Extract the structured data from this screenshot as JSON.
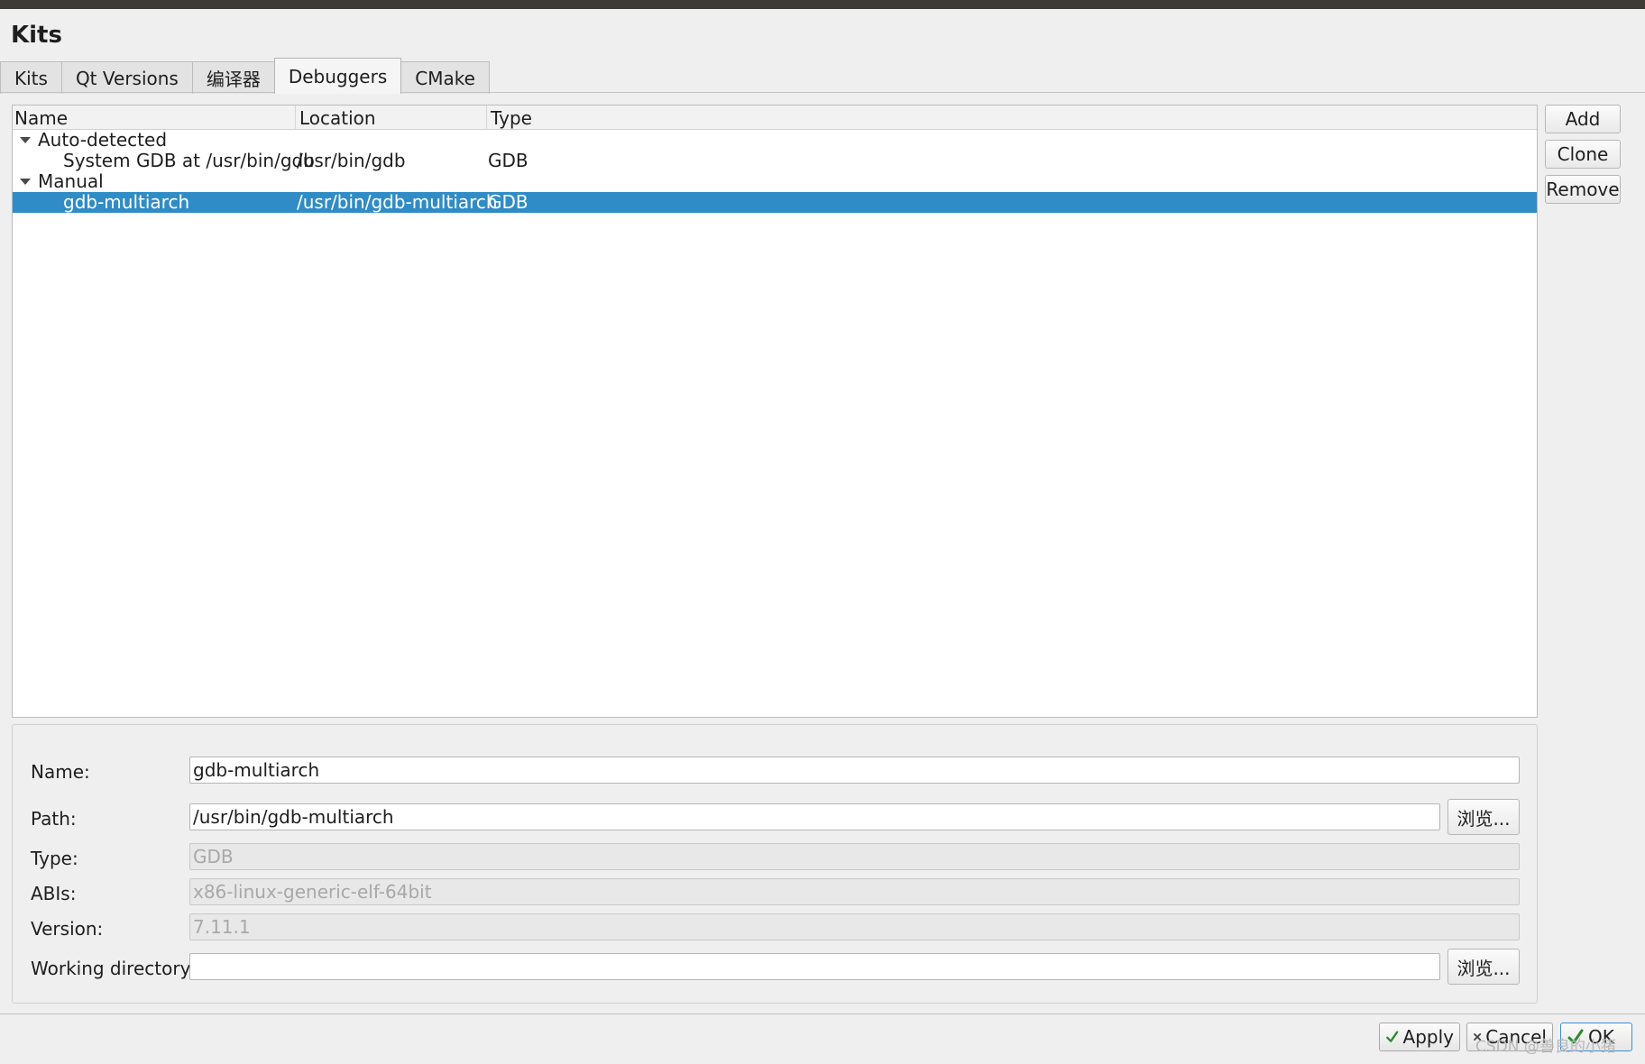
{
  "page_title": "Kits",
  "tabs": [
    {
      "label": "Kits"
    },
    {
      "label": "Qt Versions"
    },
    {
      "label": "编译器"
    },
    {
      "label": "Debuggers"
    },
    {
      "label": "CMake"
    }
  ],
  "active_tab": "Debuggers",
  "tree": {
    "columns": [
      "Name",
      "Location",
      "Type"
    ],
    "groups": [
      {
        "label": "Auto-detected",
        "items": [
          {
            "name": "System GDB at /usr/bin/gdb",
            "location": "/usr/bin/gdb",
            "type": "GDB"
          }
        ]
      },
      {
        "label": "Manual",
        "items": [
          {
            "name": "gdb-multiarch",
            "location": "/usr/bin/gdb-multiarch",
            "type": "GDB",
            "selected": true
          }
        ]
      }
    ]
  },
  "side_buttons": {
    "add": "Add",
    "clone": "Clone",
    "remove": "Remove"
  },
  "details": {
    "name_label": "Name:",
    "name_value": "gdb-multiarch",
    "path_label": "Path:",
    "path_value": "/usr/bin/gdb-multiarch",
    "type_label": "Type:",
    "type_value": "GDB",
    "abis_label": "ABIs:",
    "abis_value": "x86-linux-generic-elf-64bit",
    "version_label": "Version:",
    "version_value": "7.11.1",
    "workdir_label": "Working directory:",
    "workdir_value": "",
    "browse_label": "浏览..."
  },
  "bottom_buttons": {
    "apply": "Apply",
    "cancel": "Cancel",
    "ok": "OK"
  },
  "watermark": "CSDN @善良的小猪",
  "colors": {
    "selection": "#308cc6",
    "titlebar": "#3c3b37",
    "apply_icon": "#2e8b2e",
    "cancel_icon": "#444444"
  }
}
